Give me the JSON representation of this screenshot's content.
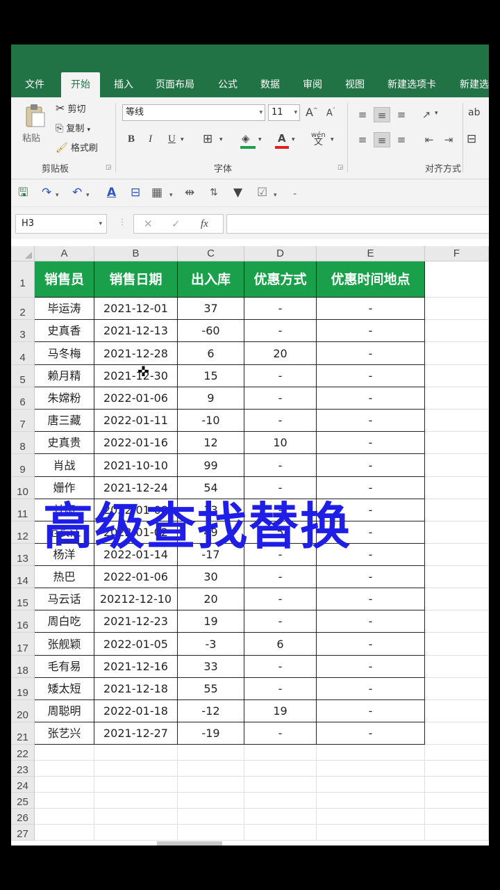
{
  "ribbon_tabs": [
    "文件",
    "开始",
    "插入",
    "页面布局",
    "公式",
    "数据",
    "审阅",
    "视图",
    "新建选项卡",
    "新建选"
  ],
  "active_tab_index": 1,
  "clipboard": {
    "paste": "粘贴",
    "cut": "剪切",
    "copy": "复制",
    "format_painter": "格式刷",
    "group": "剪贴板"
  },
  "font": {
    "name": "等线",
    "size": "11",
    "group": "字体",
    "bold": "B",
    "italic": "I",
    "underline": "U",
    "font_color_glyph": "A",
    "phonetic": "wén",
    "grow": "A",
    "shrink": "A"
  },
  "alignment": {
    "group": "对齐方式"
  },
  "wrap_glyph": "ab",
  "namebox": "H3",
  "formula_value": "",
  "fx_label": "fx",
  "columns": [
    "A",
    "B",
    "C",
    "D",
    "E",
    "F"
  ],
  "headers": [
    "销售员",
    "销售日期",
    "出入库",
    "优惠方式",
    "优惠时间地点"
  ],
  "rows": [
    [
      "毕运涛",
      "2021-12-01",
      "37",
      "-",
      "-"
    ],
    [
      "史真香",
      "2021-12-13",
      "-60",
      "-",
      "-"
    ],
    [
      "马冬梅",
      "2021-12-28",
      "6",
      "20",
      "-"
    ],
    [
      "赖月精",
      "2021-12-30",
      "15",
      "-",
      "-"
    ],
    [
      "朱嫦粉",
      "2022-01-06",
      "9",
      "-",
      "-"
    ],
    [
      "唐三藏",
      "2022-01-11",
      "-10",
      "-",
      "-"
    ],
    [
      "史真贵",
      "2022-01-16",
      "12",
      "10",
      "-"
    ],
    [
      "肖战",
      "2021-10-10",
      "99",
      "-",
      "-"
    ],
    [
      "姗作",
      "2021-12-24",
      "54",
      "-",
      "-"
    ],
    [
      "甘雨",
      "2022-01-08",
      "33",
      "-",
      "-"
    ],
    [
      "范长江",
      "2022-01-02",
      "49",
      "5",
      "-"
    ],
    [
      "杨洋",
      "2022-01-14",
      "-17",
      "-",
      "-"
    ],
    [
      "热巴",
      "2022-01-06",
      "30",
      "-",
      "-"
    ],
    [
      "马云话",
      "20212-12-10",
      "20",
      "-",
      "-"
    ],
    [
      "周白吃",
      "2021-12-23",
      "19",
      "-",
      "-"
    ],
    [
      "张舰颖",
      "2022-01-05",
      "-3",
      "6",
      "-"
    ],
    [
      "毛有易",
      "2021-12-16",
      "33",
      "-",
      "-"
    ],
    [
      "矮太短",
      "2021-12-18",
      "55",
      "-",
      "-"
    ],
    [
      "周聪明",
      "2022-01-18",
      "-12",
      "19",
      "-"
    ],
    [
      "张艺兴",
      "2021-12-27",
      "-19",
      "-",
      "-"
    ]
  ],
  "row_numbers": [
    "1",
    "2",
    "3",
    "4",
    "5",
    "6",
    "7",
    "8",
    "9",
    "10",
    "11",
    "12",
    "13",
    "14",
    "15",
    "16",
    "17",
    "18",
    "19",
    "20",
    "21",
    "22",
    "23",
    "24",
    "25",
    "26",
    "27"
  ],
  "overlay_title": "高级查找替换",
  "colors": {
    "excel_green": "#217346",
    "header_fill": "#1aa04b",
    "overlay_blue": "#1e1ee6"
  }
}
